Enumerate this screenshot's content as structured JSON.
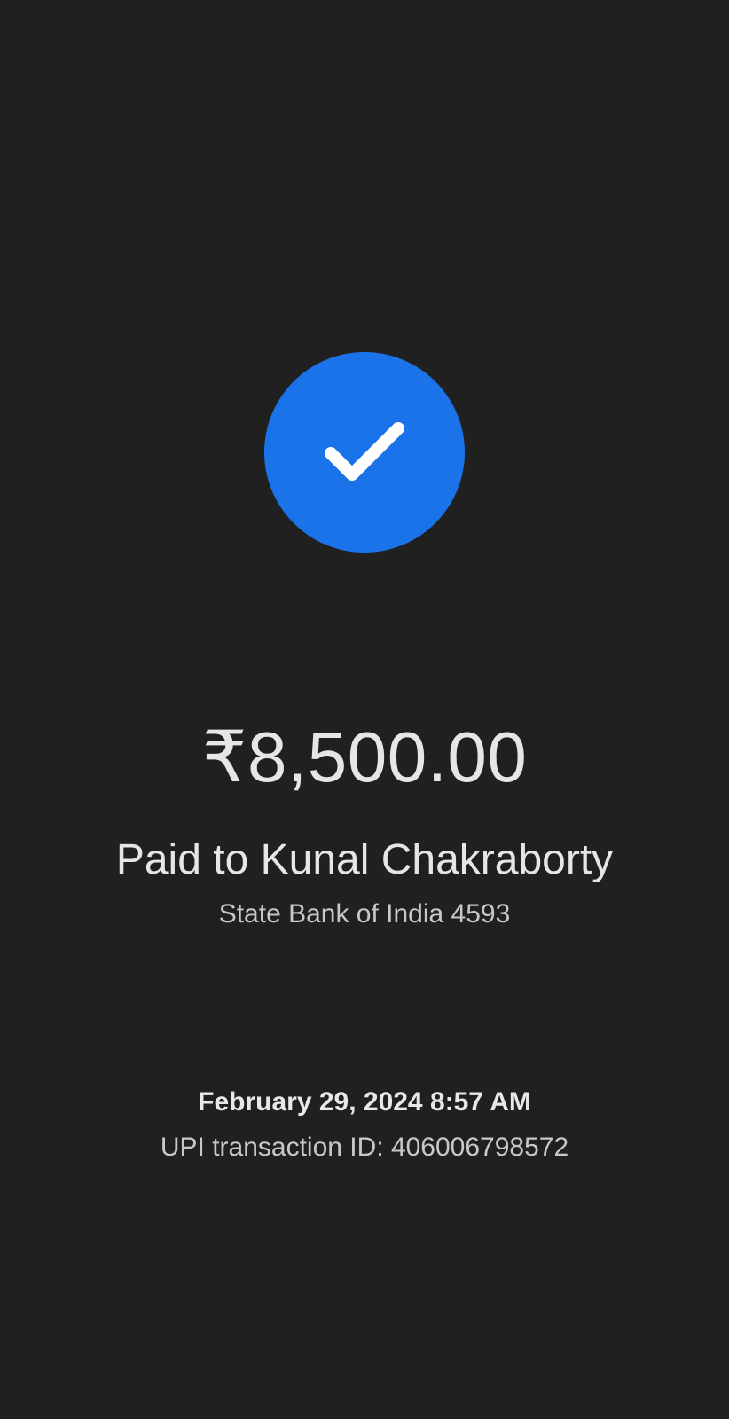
{
  "payment": {
    "status_icon": "checkmark-icon",
    "amount": "₹8,500.00",
    "payee_line": "Paid to Kunal Chakraborty",
    "bank_line": "State Bank of India 4593",
    "datetime": "February 29, 2024 8:57 AM",
    "transaction_line": "UPI transaction ID: 406006798572"
  },
  "colors": {
    "background": "#202020",
    "accent": "#1a73e8",
    "primary_text": "#e6e6e6",
    "secondary_text": "#c8c8c8"
  }
}
